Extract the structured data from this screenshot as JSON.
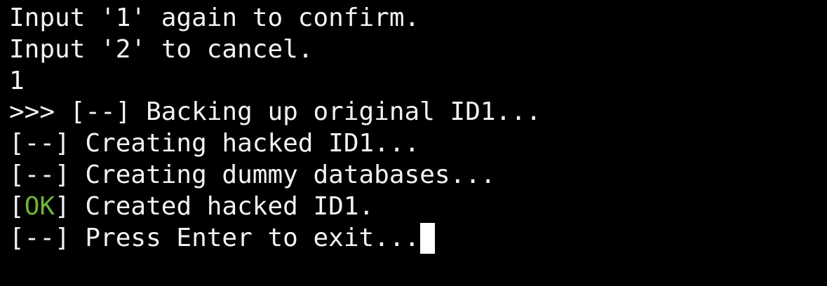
{
  "colors": {
    "background": "#000000",
    "text": "#f2f2f2",
    "ok": "#6fb33a",
    "cursor": "#ffffff"
  },
  "lines": {
    "l0": "Input '1' again to confirm.",
    "l1": "Input '2' to cancel.",
    "l2": "1",
    "l3": ">>> [--] Backing up original ID1...",
    "l4": "[--] Creating hacked ID1...",
    "l5": "[--] Creating dummy databases...",
    "l6": {
      "open": "[",
      "status": "OK",
      "rest": "] Created hacked ID1."
    },
    "l7": "[--] Press Enter to exit..."
  }
}
